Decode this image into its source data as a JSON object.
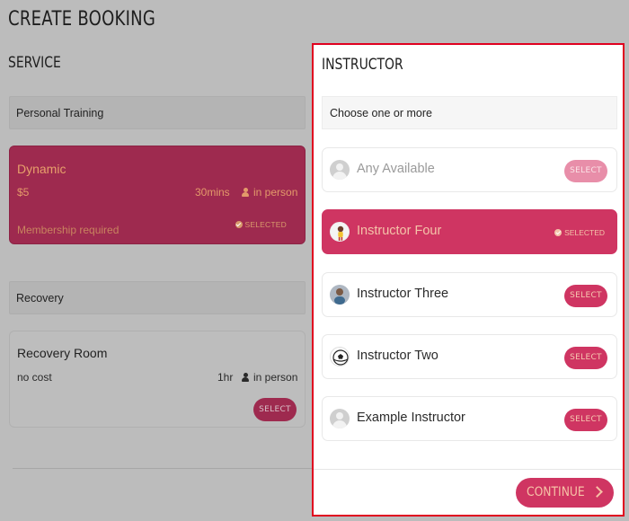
{
  "page": {
    "title": "CREATE BOOKING"
  },
  "service": {
    "heading": "SERVICE",
    "categories": [
      {
        "label": "Personal Training",
        "items": [
          {
            "name": "Dynamic",
            "price": "$5",
            "duration": "30mins",
            "location": "in person",
            "note": "Membership required",
            "status": "SELECTED"
          }
        ]
      },
      {
        "label": "Recovery",
        "items": [
          {
            "name": "Recovery Room",
            "price": "no cost",
            "duration": "1hr",
            "location": "in person",
            "button": "SELECT"
          }
        ]
      }
    ]
  },
  "instructor": {
    "heading": "INSTRUCTOR",
    "choose_label": "Choose one or more",
    "items": [
      {
        "name": "Any Available",
        "button": "SELECT",
        "avatar": "person-placeholder-icon"
      },
      {
        "name": "Instructor Four",
        "status": "SELECTED",
        "avatar": "female-avatar"
      },
      {
        "name": "Instructor Three",
        "button": "SELECT",
        "avatar": "male-avatar"
      },
      {
        "name": "Instructor Two",
        "button": "SELECT",
        "avatar": "soccer-ball-avatar"
      },
      {
        "name": "Example Instructor",
        "button": "SELECT",
        "avatar": "person-placeholder-icon"
      }
    ],
    "continue_label": "CONTINUE"
  },
  "colors": {
    "accent": "#cf3562",
    "accent_dark": "#9e2a4f",
    "highlight_border": "#e0001f"
  }
}
